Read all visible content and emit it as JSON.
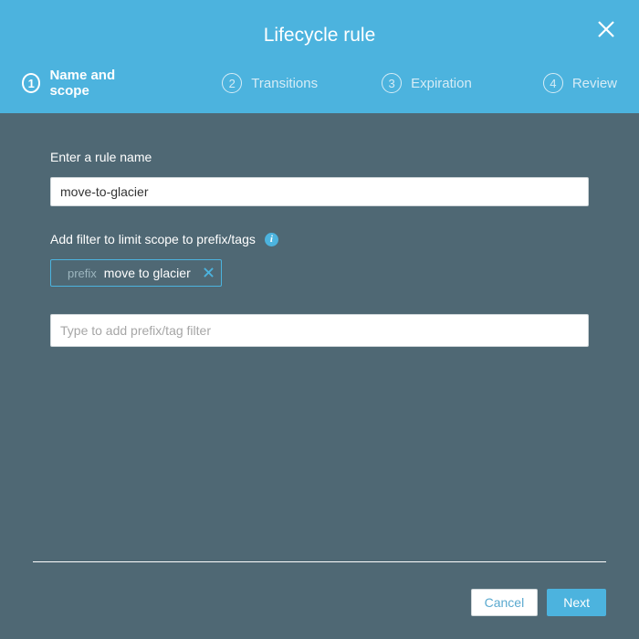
{
  "header": {
    "title": "Lifecycle rule"
  },
  "steps": [
    {
      "num": "1",
      "label": "Name and scope"
    },
    {
      "num": "2",
      "label": "Transitions"
    },
    {
      "num": "3",
      "label": "Expiration"
    },
    {
      "num": "4",
      "label": "Review"
    }
  ],
  "form": {
    "rule_name_label": "Enter a rule name",
    "rule_name_value": "move-to-glacier",
    "filter_label": "Add filter to limit scope to prefix/tags",
    "chip_key": "prefix",
    "chip_value": "move to glacier",
    "filter_placeholder": "Type to add prefix/tag filter"
  },
  "footer": {
    "cancel": "Cancel",
    "next": "Next"
  }
}
